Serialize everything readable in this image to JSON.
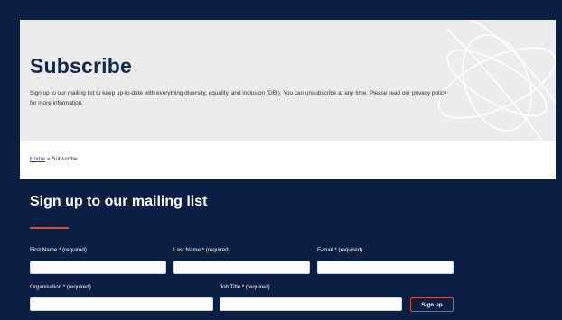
{
  "hero": {
    "title": "Subscribe",
    "description": "Sign up to our mailing list to keep up-to-date with everything diversity, equality, and inclusion (DEI). You can unsubscribe at any time. Please read our privacy policy for more information."
  },
  "breadcrumb": {
    "home": "Home",
    "separator": "»",
    "current": "Subscribe"
  },
  "form": {
    "title": "Sign up to our mailing list",
    "first_name_label": "First Name * (required)",
    "last_name_label": "Last Name * (required)",
    "email_label": "E-mail * (required)",
    "organisation_label": "Organisation * (required)",
    "job_title_label": "Job Title * (required)",
    "submit_label": "Sign up",
    "first_name_value": "",
    "last_name_value": "",
    "email_value": "",
    "organisation_value": "",
    "job_title_value": ""
  },
  "colors": {
    "navy": "#0b1f45",
    "accent": "#d2522e",
    "hero_bg": "#ececec",
    "title": "#13284f"
  }
}
